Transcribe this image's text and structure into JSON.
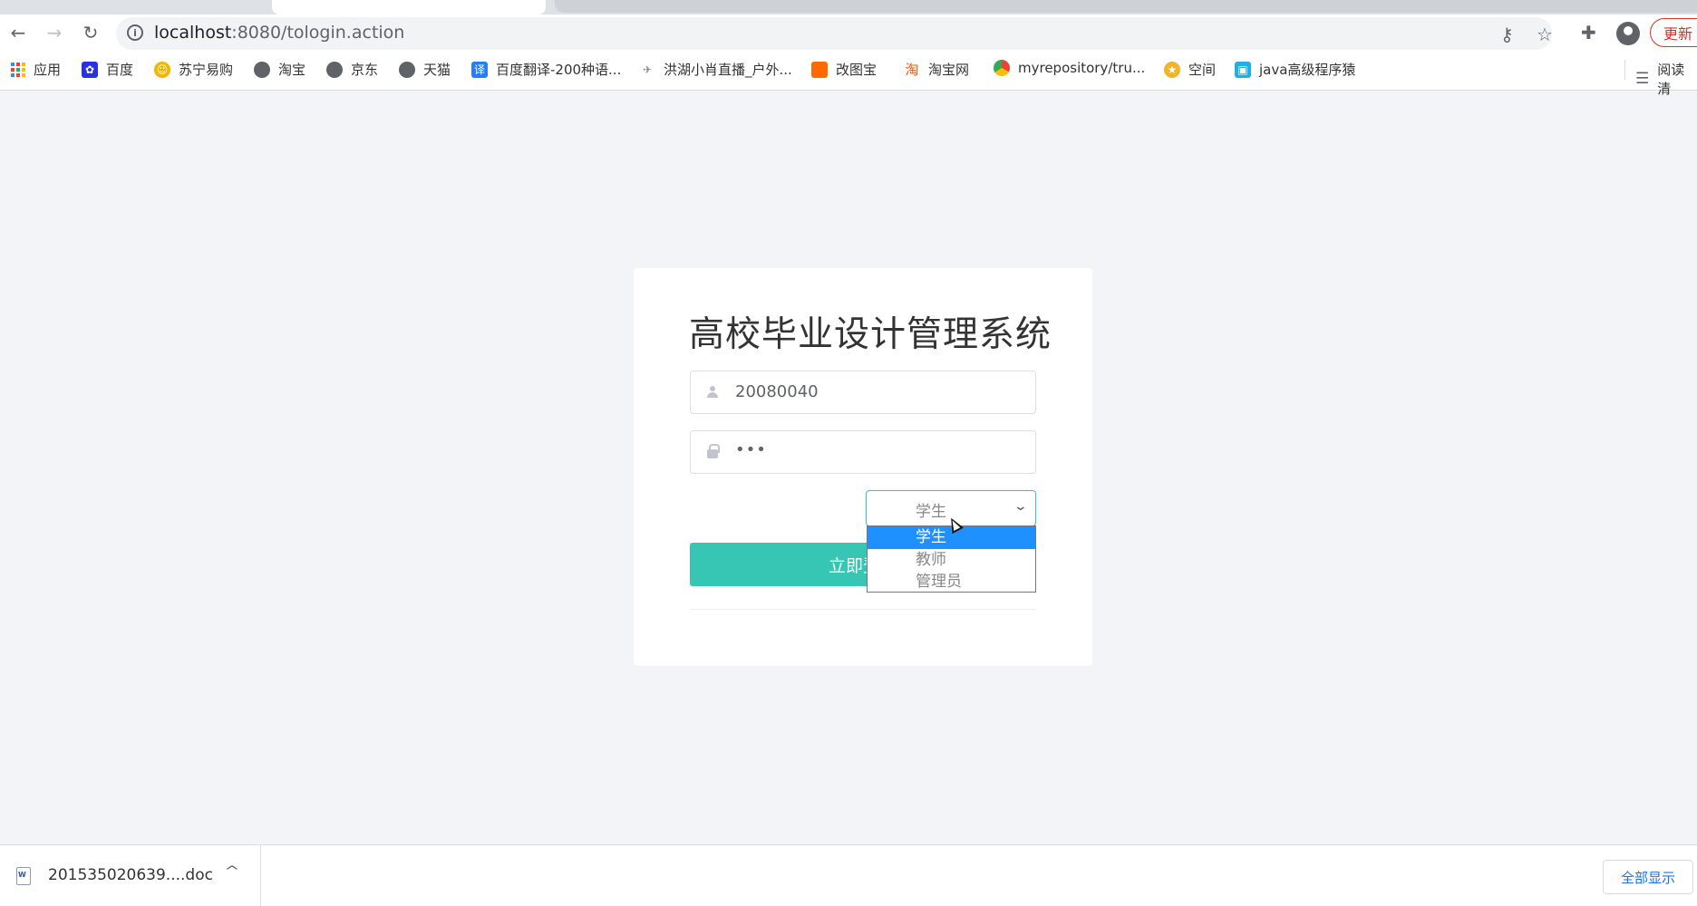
{
  "browser": {
    "url_host": "localhost",
    "url_path": ":8080/tologin.action",
    "update_label": "更新"
  },
  "bookmarks": [
    {
      "label": "应用",
      "icon": "apps-grid-icon"
    },
    {
      "label": "百度",
      "icon": "baidu-icon"
    },
    {
      "label": "苏宁易购",
      "icon": "suning-icon"
    },
    {
      "label": "淘宝",
      "icon": "globe-icon"
    },
    {
      "label": "京东",
      "icon": "globe-icon"
    },
    {
      "label": "天猫",
      "icon": "globe-icon"
    },
    {
      "label": "百度翻译-200种语...",
      "icon": "translate-icon"
    },
    {
      "label": "洪湖小肖直播_户外...",
      "icon": "bird-icon"
    },
    {
      "label": "改图宝",
      "icon": "gaitubao-icon"
    },
    {
      "label": "淘宝网",
      "icon": "taobao-icon"
    },
    {
      "label": "myrepository/tru...",
      "icon": "chrome-icon"
    },
    {
      "label": "空间",
      "icon": "qzone-icon"
    },
    {
      "label": "java高级程序猿",
      "icon": "bilibili-icon"
    }
  ],
  "reading_list_label": "阅读清",
  "login": {
    "title": "高校毕业设计管理系统",
    "username_value": "20080040",
    "password_mask": "•••",
    "role_selected": "学生",
    "role_options": [
      "学生",
      "教师",
      "管理员"
    ],
    "submit_label": "立即登录"
  },
  "download": {
    "file_name": "201535020639....doc",
    "show_all_label": "全部显示"
  },
  "colors": {
    "accent": "#36c6b3",
    "option_highlight": "#1e90ff"
  }
}
